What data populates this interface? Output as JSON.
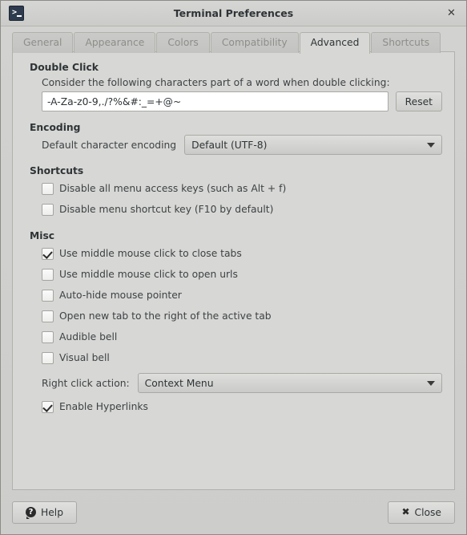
{
  "window": {
    "title": "Terminal Preferences",
    "app_icon": "terminal-icon",
    "close_glyph": "✕"
  },
  "tabs": [
    {
      "label": "General",
      "active": false
    },
    {
      "label": "Appearance",
      "active": false
    },
    {
      "label": "Colors",
      "active": false
    },
    {
      "label": "Compatibility",
      "active": false
    },
    {
      "label": "Advanced",
      "active": true
    },
    {
      "label": "Shortcuts",
      "active": false
    }
  ],
  "sections": {
    "double_click": {
      "title": "Double Click",
      "description": "Consider the following characters part of a word when double clicking:",
      "word_chars_value": "-A-Za-z0-9,./?%&#:_=+@~",
      "word_chars_placeholder": "",
      "reset_label": "Reset"
    },
    "encoding": {
      "title": "Encoding",
      "label": "Default character encoding",
      "value": "Default (UTF-8)"
    },
    "shortcuts": {
      "title": "Shortcuts",
      "options": [
        {
          "label": "Disable all menu access keys (such as Alt + f)",
          "checked": false
        },
        {
          "label": "Disable menu shortcut key (F10 by default)",
          "checked": false
        }
      ]
    },
    "misc": {
      "title": "Misc",
      "options": [
        {
          "label": "Use middle mouse click to close tabs",
          "checked": true
        },
        {
          "label": "Use middle mouse click to open urls",
          "checked": false
        },
        {
          "label": "Auto-hide mouse pointer",
          "checked": false
        },
        {
          "label": "Open new tab to the right of the active tab",
          "checked": false
        },
        {
          "label": "Audible bell",
          "checked": false
        },
        {
          "label": "Visual bell",
          "checked": false
        }
      ],
      "right_click": {
        "label": "Right click action:",
        "value": "Context Menu"
      },
      "hyperlinks": {
        "label": "Enable Hyperlinks",
        "checked": true
      }
    }
  },
  "actions": {
    "help_label": "Help",
    "help_icon": "question-mark-icon",
    "close_label": "Close",
    "close_icon": "cross-icon"
  },
  "colors": {
    "window_bg": "#cdcdcb",
    "panel_bg": "#d7d7d5",
    "border": "#b0b0ac",
    "text": "#2e3436",
    "muted_text": "#8d8d8a",
    "input_bg": "#ffffff",
    "icon_navy": "#2e3b4e"
  }
}
